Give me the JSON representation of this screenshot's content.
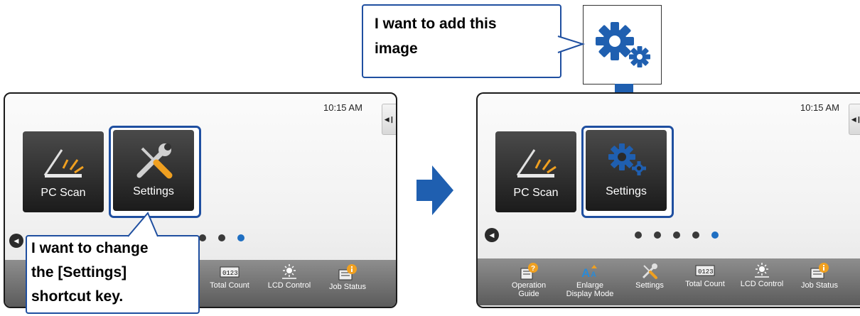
{
  "callout_top": {
    "line1": "I want to add this",
    "line2": "image"
  },
  "callout_bottom": {
    "line1": "I want to change",
    "line2": "the [Settings]",
    "line3": "shortcut key."
  },
  "left_screen": {
    "clock": "10:15 AM",
    "side_tab_glyph": "◀❙",
    "tiles": {
      "pc_scan": "PC Scan",
      "settings": "Settings"
    },
    "bar": {
      "total_count": "Total Count",
      "lcd_control": "LCD Control",
      "job_status": "Job Status"
    }
  },
  "right_screen": {
    "clock": "10:15 AM",
    "side_tab_glyph": "◀❙",
    "tiles": {
      "pc_scan": "PC Scan",
      "settings": "Settings"
    },
    "bar": {
      "operation_guide_1": "Operation",
      "operation_guide_2": "Guide",
      "enlarge_1": "Enlarge",
      "enlarge_2": "Display Mode",
      "settings": "Settings",
      "total_count": "Total Count",
      "lcd_control": "LCD Control",
      "job_status": "Job Status"
    }
  },
  "counter_digits": "0123",
  "colors": {
    "accent_blue": "#1f4fa0",
    "gear_blue": "#1f5fb0",
    "dot_active": "#1f6fc2",
    "badge_orange": "#f0a020"
  },
  "icons": [
    "gear-icon",
    "scanner-icon",
    "wrench-screwdriver-icon",
    "counter-icon",
    "brightness-icon",
    "job-status-icon",
    "help-icon",
    "enlarge-icon"
  ]
}
